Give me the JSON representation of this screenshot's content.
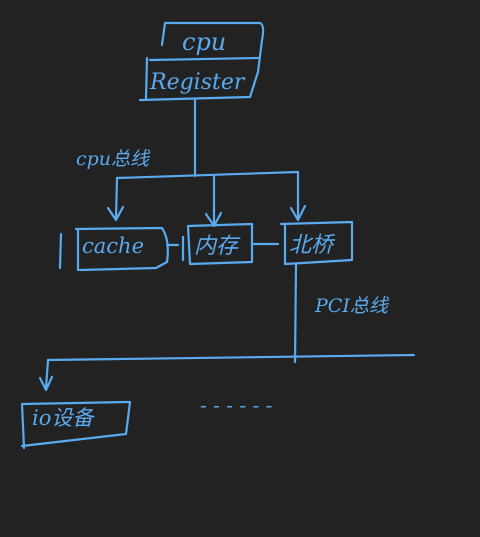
{
  "colors": {
    "background": "#222222",
    "ink": "#5aaaf0"
  },
  "nodes": {
    "cpu_top": "cpu",
    "cpu_register": "Register",
    "cache": "cache",
    "memory": "内存",
    "north_bridge": "北桥",
    "io_device": "io设备"
  },
  "labels": {
    "cpu_bus": "cpu总线",
    "pci_bus": "PCI总线",
    "ellipsis": "- - - - - -"
  }
}
